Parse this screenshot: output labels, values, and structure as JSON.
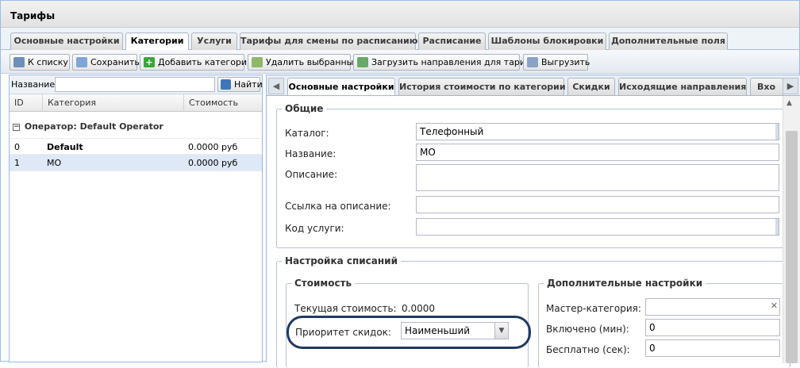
{
  "window": {
    "title": "Тарифы"
  },
  "main_tabs": [
    "Основные настройки",
    "Категории",
    "Услуги",
    "Тарифы для смены по расписанию",
    "Расписание",
    "Шаблоны блокировки",
    "Дополнительные поля"
  ],
  "main_tab_active": "Категории",
  "toolbar": {
    "back": "К списку",
    "save": "Сохранить",
    "add_category": "Добавить категорию",
    "delete_selected": "Удалить выбранные",
    "load_directions": "Загрузить направления для тарифа",
    "export": "Выгрузить"
  },
  "search": {
    "label": "Название:",
    "value": "",
    "button": "Найти"
  },
  "grid": {
    "columns": [
      "ID",
      "Категория",
      "Стоимость"
    ],
    "group": "Оператор: Default Operator",
    "rows": [
      {
        "id": "0",
        "category": "Default",
        "cost": "0.0000 руб",
        "bold": true
      },
      {
        "id": "1",
        "category": "МО",
        "cost": "0.0000 руб",
        "bold": false
      }
    ]
  },
  "detail_tabs": [
    "Основные настройки",
    "История стоимости по категории",
    "Скидки",
    "Исходящие направления",
    "Вхо"
  ],
  "detail_tab_active": "Основные настройки",
  "general": {
    "legend": "Общие",
    "catalog_label": "Каталог:",
    "catalog_value": "Телефонный",
    "name_label": "Название:",
    "name_value": "МО",
    "description_label": "Описание:",
    "description_value": "",
    "link_label": "Ссылка на описание:",
    "link_value": "",
    "service_code_label": "Код услуги:",
    "service_code_value": ""
  },
  "charges": {
    "legend": "Настройка списаний",
    "cost": {
      "legend": "Стоимость",
      "current_label": "Текущая стоимость:",
      "current_value": "0.0000",
      "priority_label": "Приоритет скидок:",
      "priority_value": "Наименьший"
    },
    "extra": {
      "legend": "Дополнительные настройки",
      "master_label": "Мастер-категория:",
      "master_value": "",
      "included_label": "Включено (мин):",
      "included_value": "0",
      "free_label": "Бесплатно (сек):",
      "free_value": "0"
    }
  },
  "colors": {
    "accent": "#99bbe8",
    "highlight_ring": "#1f3a5f",
    "selected_row": "#dfe8f6"
  }
}
